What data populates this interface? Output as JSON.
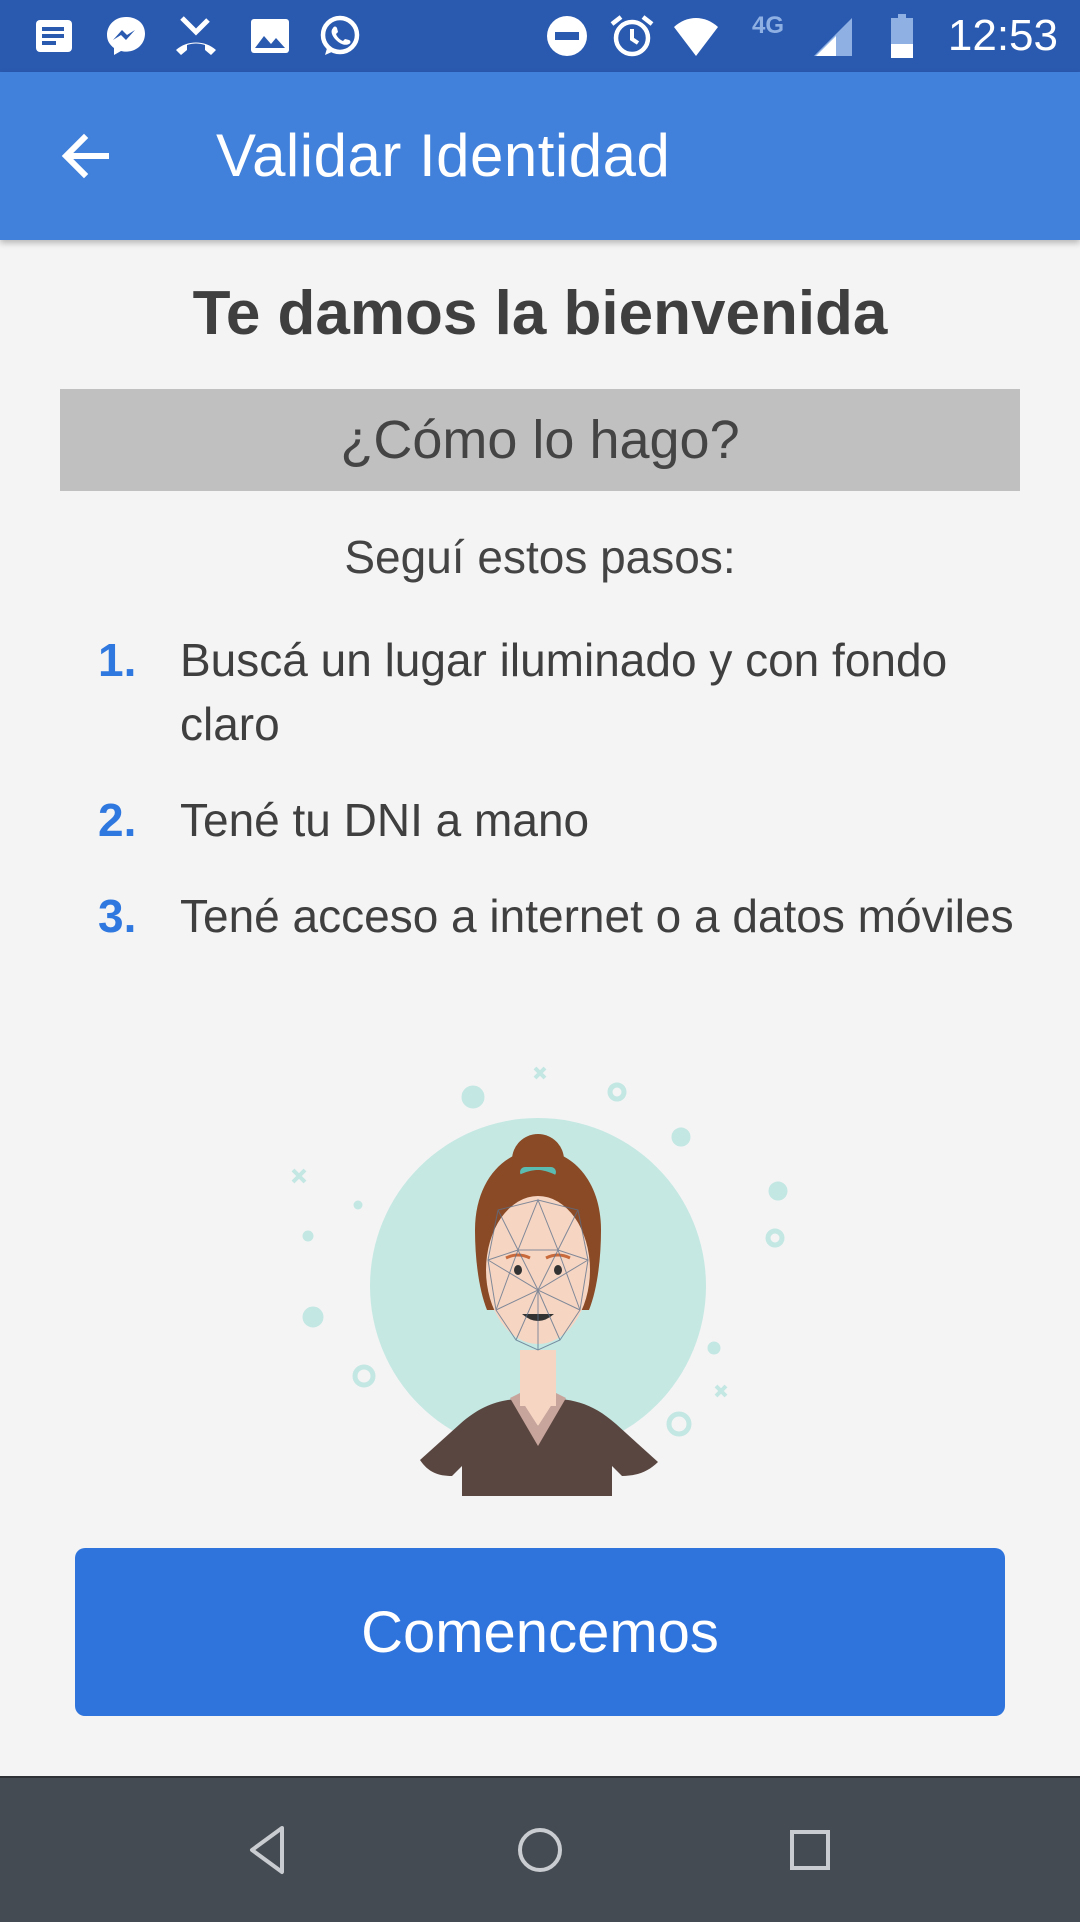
{
  "status_bar": {
    "time": "12:53",
    "network": "4G",
    "left_icons": [
      "notes-icon",
      "messenger-icon",
      "missed-call-icon",
      "image-icon",
      "whatsapp-icon"
    ],
    "right_icons": [
      "do-not-disturb-icon",
      "alarm-icon",
      "wifi-icon",
      "cell-signal-icon",
      "battery-icon"
    ]
  },
  "app_bar": {
    "title": "Validar Identidad",
    "back_icon": "arrow-back-icon"
  },
  "content": {
    "welcome": "Te damos la bienvenida",
    "how_title": "¿Cómo lo hago?",
    "steps_intro": "Seguí estos pasos:",
    "steps": [
      {
        "number": "1.",
        "text": "Buscá un lugar iluminado y con fondo claro"
      },
      {
        "number": "2.",
        "text": "Tené tu DNI a mano"
      },
      {
        "number": "3.",
        "text": "Tené acceso a internet o a datos móviles"
      }
    ]
  },
  "cta": {
    "label": "Comencemos"
  },
  "colors": {
    "status_bar": "#2a5ab0",
    "app_bar": "#4181db",
    "accent": "#2f74dc",
    "step_number": "#2f78e0",
    "how_box": "#c0c0c0",
    "background": "#f4f4f4",
    "nav_bar": "#454b52"
  },
  "nav_bar": {
    "buttons": [
      "back-triangle-icon",
      "home-circle-icon",
      "recents-square-icon"
    ]
  }
}
